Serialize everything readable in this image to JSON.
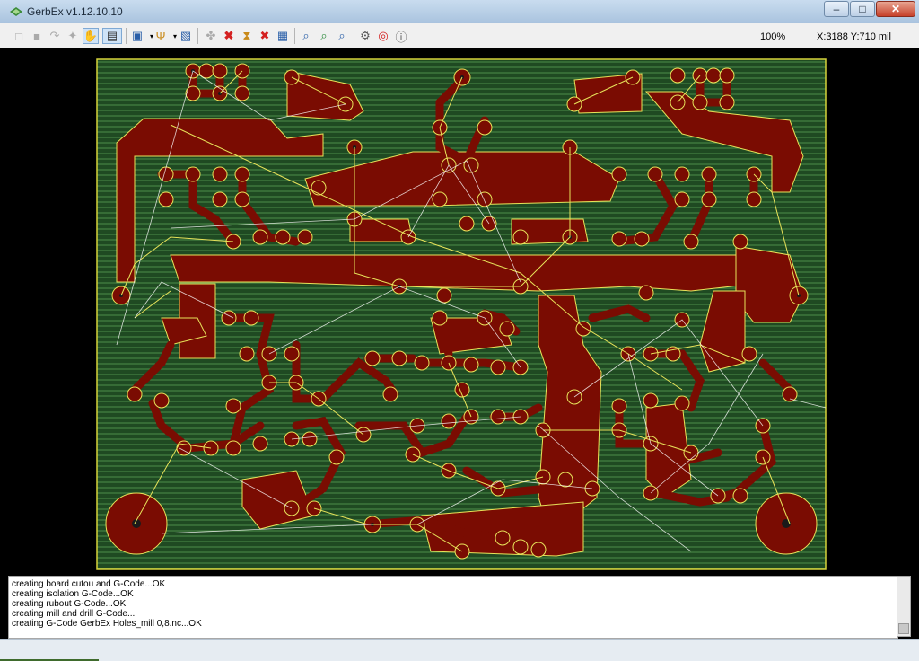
{
  "window": {
    "title": "GerbEx v1.12.10.10"
  },
  "toolbar": {
    "zoom_level": "100%",
    "coordinates": "X:3188  Y:710 mil",
    "icons": [
      "new-icon",
      "open-icon",
      "export-icon",
      "pointer-icon",
      "move-icon",
      "measure-icon",
      "layers-icon",
      "probe-icon",
      "save-icon",
      "drill-icon",
      "delete-icon",
      "delete-net-icon",
      "delete-all-icon",
      "copy-icon",
      "zoom-in-icon",
      "zoom-out-icon",
      "zoom-fit-icon",
      "settings-icon",
      "help-icon",
      "info-icon"
    ]
  },
  "console": {
    "lines": [
      "creating board cutou and G-Code...OK",
      "creating isolation G-Code...OK",
      "creating rubout G-Code...OK",
      "creating mill and drill G-Code...",
      "creating G-Code GerbEx Holes_mill 0,8.nc...OK"
    ]
  },
  "colors": {
    "board": "#1f4a22",
    "copper": "#7a0c02",
    "isolation": "#e8e35a",
    "ratsnest": "#ffffff"
  }
}
